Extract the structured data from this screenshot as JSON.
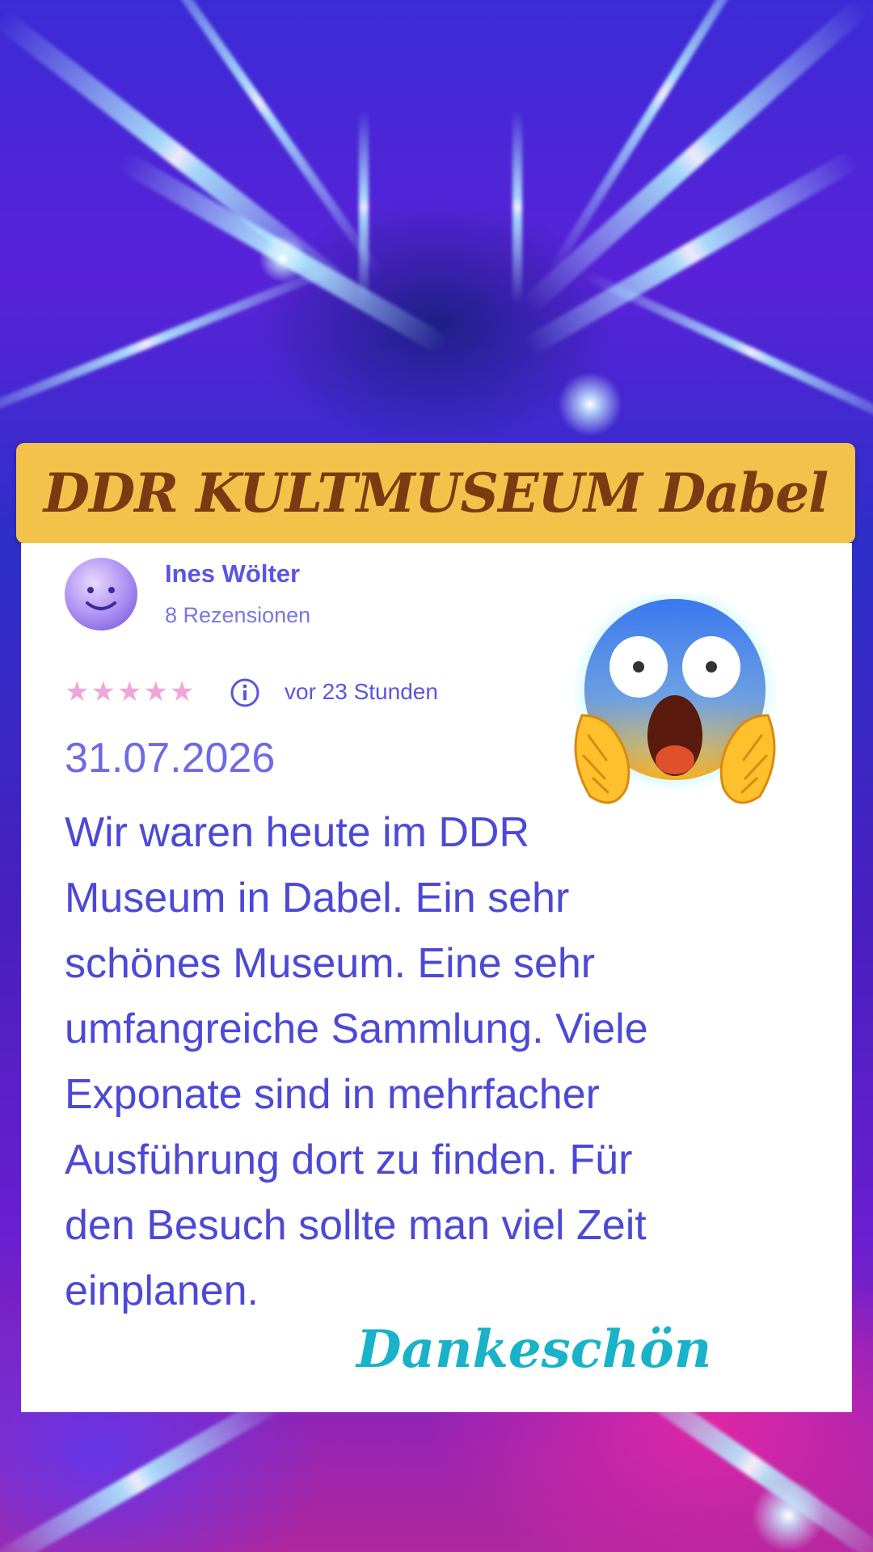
{
  "banner": {
    "title": "DDR KULTMUSEUM Dabel"
  },
  "review": {
    "reviewer_name": "Ines Wölter",
    "reviewer_count": "8 Rezensionen",
    "stars": "★★★★★",
    "time": "vor 23 Stunden",
    "date": "31.07.2026",
    "lines": [
      "Wir waren heute im DDR",
      "Museum in Dabel. Ein sehr",
      "schönes Museum. Eine sehr",
      "umfangreiche Sammlung. Viele",
      "Exponate sind in mehrfacher",
      "Ausführung dort zu finden. Für",
      "den Besuch sollte man viel Zeit",
      "einplanen."
    ]
  },
  "overlay": {
    "thanks": "Dankeschön",
    "emoji_icon": "screaming-face-emoji"
  },
  "colors": {
    "banner_bg": "#f2c24a",
    "banner_text": "#7a3a12",
    "review_text": "#4c49d6",
    "thanks_text": "#19b2c8"
  }
}
